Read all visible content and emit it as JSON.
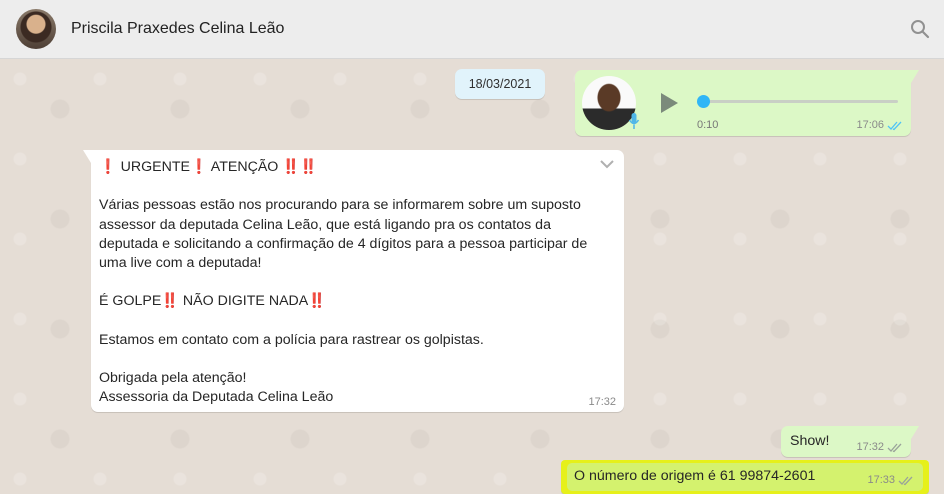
{
  "header": {
    "contact_name": "Priscila Praxedes Celina Leão"
  },
  "chat": {
    "date": "18/03/2021",
    "audio_message": {
      "duration": "0:10",
      "time": "17:06",
      "status": "read"
    },
    "incoming_message": {
      "lines": [
        "❗ URGENTE❗ ATENÇÃO ‼️‼️",
        "",
        "Várias pessoas estão nos procurando para se informarem sobre um suposto",
        "assessor da deputada Celina Leão, que está ligando pra os contatos da",
        "deputada e solicitando a confirmação de 4 dígitos para a pessoa participar de",
        "uma live com a deputada!",
        "",
        "É GOLPE‼️ NÃO DIGITE NADA‼️",
        "",
        "Estamos em contato com a polícia para rastrear os golpistas.",
        "",
        "Obrigada pela atenção!",
        "Assessoria da Deputada Celina Leão"
      ],
      "time": "17:32"
    },
    "reply_show": {
      "text": "Show!",
      "time": "17:32"
    },
    "reply_origin": {
      "text": "O número de origem é 61 99874-2601",
      "time": "17:33",
      "highlight_color": "#e6f01a"
    }
  },
  "colors": {
    "outgoing_bubble": "#dcf8c6",
    "incoming_bubble": "#ffffff",
    "date_pill": "#e1f3fb",
    "audio_progress": "#30b6f6",
    "chat_background": "#e5ddd5"
  }
}
